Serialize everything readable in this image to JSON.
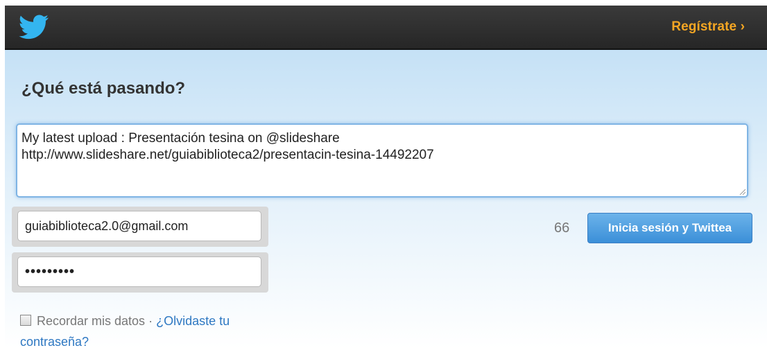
{
  "header": {
    "register_label": "Regístrate ›"
  },
  "compose": {
    "heading": "¿Qué está pasando?",
    "tweet_text": "My latest upload : Presentación tesina on @slideshare\nhttp://www.slideshare.net/guiabiblioteca2/presentacin-tesina-14492207",
    "char_counter": "66",
    "submit_label": "Inicia sesión y Twittea"
  },
  "login": {
    "email_value": "guiabiblioteca2.0@gmail.com",
    "password_masked": "•••••••••",
    "remember_label": "Recordar mis datos",
    "separator": "·",
    "forgot_label": "¿Olvidaste tu contraseña?"
  },
  "colors": {
    "topbar": "#2e2e2e",
    "accent_orange": "#f5a623",
    "link_blue": "#2e78c2",
    "button_blue": "#4a9de0"
  },
  "icons": {
    "logo": "twitter-bird-icon",
    "checkbox": "checkbox-icon",
    "resize": "resize-handle-icon"
  }
}
